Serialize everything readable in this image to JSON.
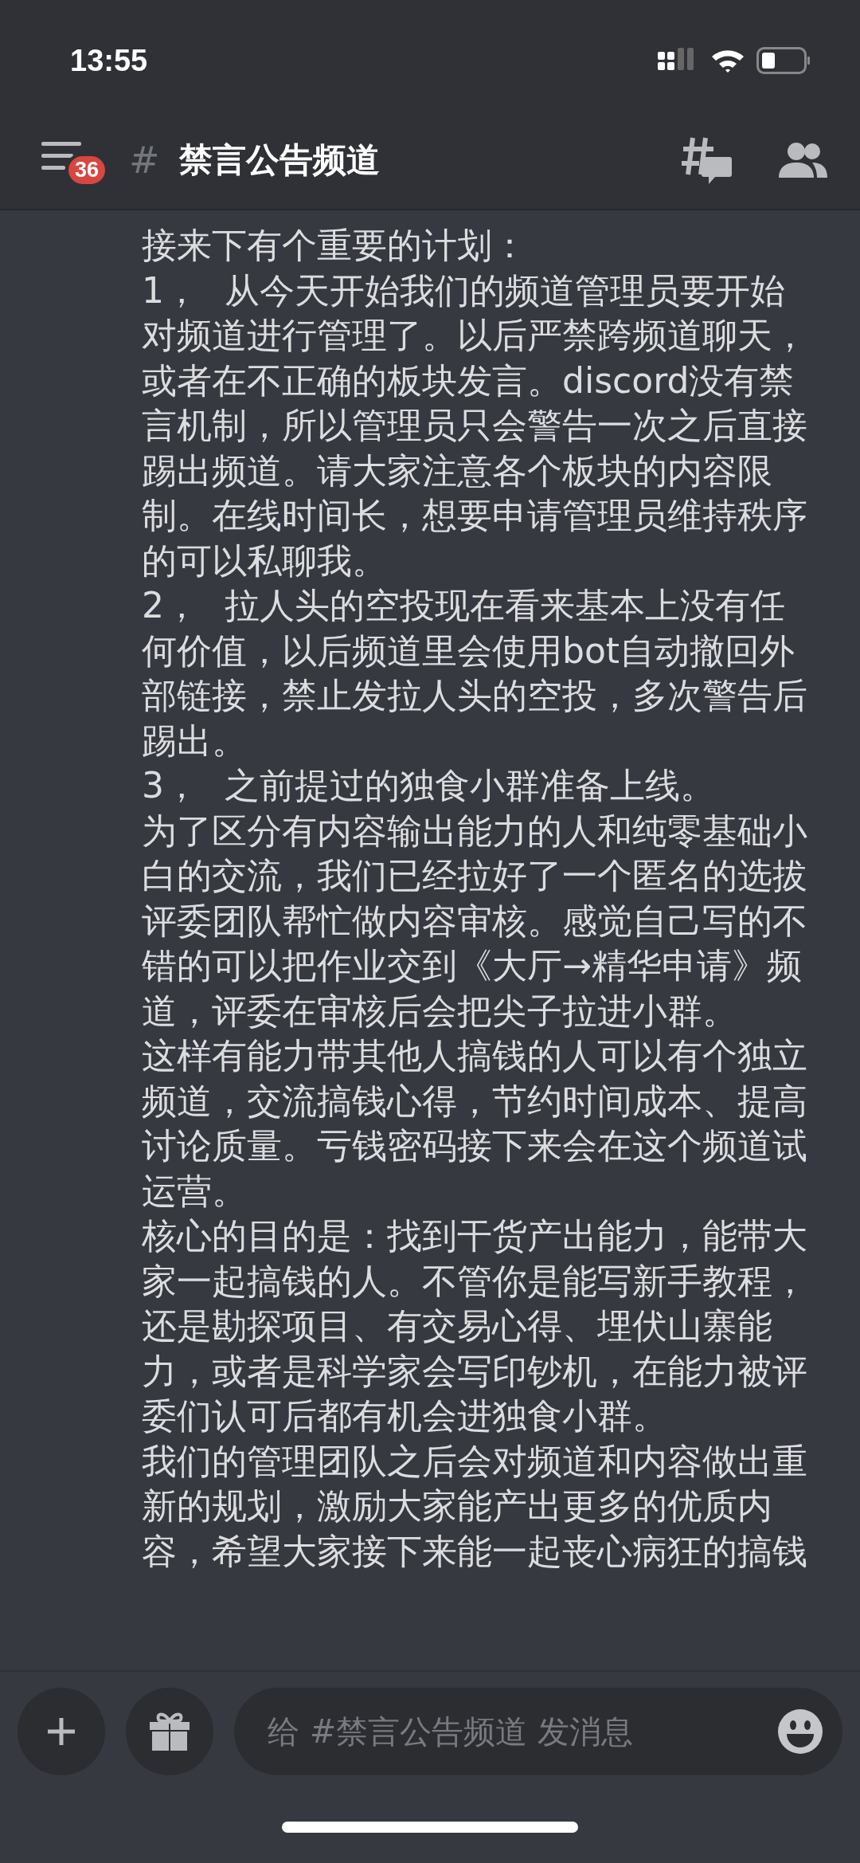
{
  "status_bar": {
    "time": "13:55"
  },
  "header": {
    "unread_count": "36",
    "channel_hash": "#",
    "channel_name": "禁言公告频道"
  },
  "messages": [
    {
      "kind": "plain",
      "text": "接来下有个重要的计划："
    },
    {
      "kind": "numbered",
      "number": "1，",
      "text": "从今天开始我们的频道管理员要开始对频道进行管理了。以后严禁跨频道聊天，或者在不正确的板块发言。discord没有禁言机制，所以管理员只会警告一次之后直接踢出频道。请大家注意各个板块的内容限制。在线时间长，想要申请管理员维持秩序的可以私聊我。"
    },
    {
      "kind": "numbered",
      "number": "2，",
      "text": "拉人头的空投现在看来基本上没有任何价值，以后频道里会使用bot自动撤回外部链接，禁止发拉人头的空投，多次警告后踢出。"
    },
    {
      "kind": "numbered",
      "number": "3，",
      "text": "之前提过的独食小群准备上线。"
    },
    {
      "kind": "plain",
      "text": "为了区分有内容输出能力的人和纯零基础小白的交流，我们已经拉好了一个匿名的选拔评委团队帮忙做内容审核。感觉自己写的不错的可以把作业交到《大厅→精华申请》频道，评委在审核后会把尖子拉进小群。"
    },
    {
      "kind": "plain",
      "text": "这样有能力带其他人搞钱的人可以有个独立频道，交流搞钱心得，节约时间成本、提高讨论质量。亏钱密码接下来会在这个频道试运营。"
    },
    {
      "kind": "plain",
      "text": "核心的目的是：找到干货产出能力，能带大家一起搞钱的人。不管你是能写新手教程，还是勘探项目、有交易心得、埋伏山寨能力，或者是科学家会写印钞机，在能力被评委们认可后都有机会进独食小群。"
    },
    {
      "kind": "plain",
      "text": "我们的管理团队之后会对频道和内容做出重新的规划，激励大家能产出更多的优质内容，希望大家接下来能一起丧心病狂的搞钱"
    }
  ],
  "composer": {
    "placeholder": "给 #禁言公告频道 发消息"
  }
}
